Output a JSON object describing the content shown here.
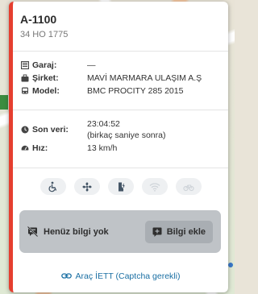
{
  "vehicle": {
    "title": "A-1100",
    "plate": "34 HO 1775"
  },
  "details": {
    "garage": {
      "label": "Garaj:",
      "value": "—",
      "icon": "garage-icon"
    },
    "company": {
      "label": "Şirket:",
      "value": "MAVİ MARMARA ULAŞIM A.Ş",
      "icon": "briefcase-icon"
    },
    "model": {
      "label": "Model:",
      "value": "BMC PROCITY 285 2015",
      "icon": "bus-icon"
    }
  },
  "status": {
    "last_data": {
      "label": "Son veri:",
      "value": "23:04:52",
      "sub": "(birkaç saniye sonra)",
      "icon": "clock-icon"
    },
    "speed": {
      "label": "Hız:",
      "value": "13 km/h",
      "icon": "speedometer-icon"
    }
  },
  "features": [
    {
      "icon": "wheelchair-icon",
      "enabled": true
    },
    {
      "icon": "fan-icon",
      "enabled": true
    },
    {
      "icon": "usb-charging-icon",
      "enabled": true
    },
    {
      "icon": "wifi-icon",
      "enabled": false
    },
    {
      "icon": "bicycle-icon",
      "enabled": false
    }
  ],
  "info": {
    "empty_label": "Henüz bilgi yok",
    "add_label": "Bilgi ekle"
  },
  "link": {
    "label": "Araç İETT (Captcha gerekli)"
  },
  "colors": {
    "accent_bar": "#e53e2f",
    "link": "#1a6fa3",
    "info_box": "#bfc3c7"
  }
}
